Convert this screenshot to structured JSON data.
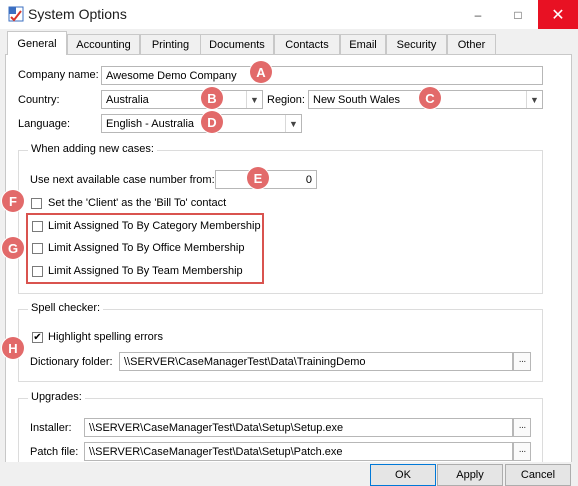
{
  "window": {
    "title": "System Options",
    "controls": {
      "minimize": "–",
      "maximize": "□",
      "close": "✕"
    }
  },
  "tabs": [
    {
      "label": "General",
      "active": true
    },
    {
      "label": "Accounting"
    },
    {
      "label": "Printing"
    },
    {
      "label": "Documents"
    },
    {
      "label": "Contacts"
    },
    {
      "label": "Email"
    },
    {
      "label": "Security"
    },
    {
      "label": "Other"
    }
  ],
  "general": {
    "company_name_label": "Company name:",
    "company_name_value": "Awesome Demo Company",
    "country_label": "Country:",
    "country_value": "Australia",
    "region_label": "Region:",
    "region_value": "New South Wales",
    "language_label": "Language:",
    "language_value": "English - Australia"
  },
  "new_cases": {
    "title": "When adding new cases:",
    "next_case_label": "Use next available case number from:",
    "next_case_value": "0",
    "client_bill_to_label": "Set the 'Client' as the 'Bill To' contact",
    "category_label": "Limit Assigned To By Category Membership",
    "office_label": "Limit Assigned To By Office Membership",
    "team_label": "Limit Assigned To By Team Membership"
  },
  "spell_checker": {
    "title": "Spell checker:",
    "highlight_label": "Highlight spelling errors",
    "highlight_checked": "✔",
    "dictionary_label": "Dictionary folder:",
    "dictionary_value": "\\\\SERVER\\CaseManagerTest\\Data\\TrainingDemo"
  },
  "upgrades": {
    "title": "Upgrades:",
    "installer_label": "Installer:",
    "installer_value": "\\\\SERVER\\CaseManagerTest\\Data\\Setup\\Setup.exe",
    "patch_label": "Patch file:",
    "patch_value": "\\\\SERVER\\CaseManagerTest\\Data\\Setup\\Patch.exe"
  },
  "browse_label": "···",
  "dropdown_arrow": "▼",
  "buttons": {
    "ok": "OK",
    "apply": "Apply",
    "cancel": "Cancel"
  },
  "markers": [
    "A",
    "B",
    "C",
    "D",
    "E",
    "F",
    "G",
    "H"
  ],
  "colors": {
    "marker": "#e26a6a",
    "highlight_border": "#d9534f",
    "close_button": "#e81123"
  }
}
